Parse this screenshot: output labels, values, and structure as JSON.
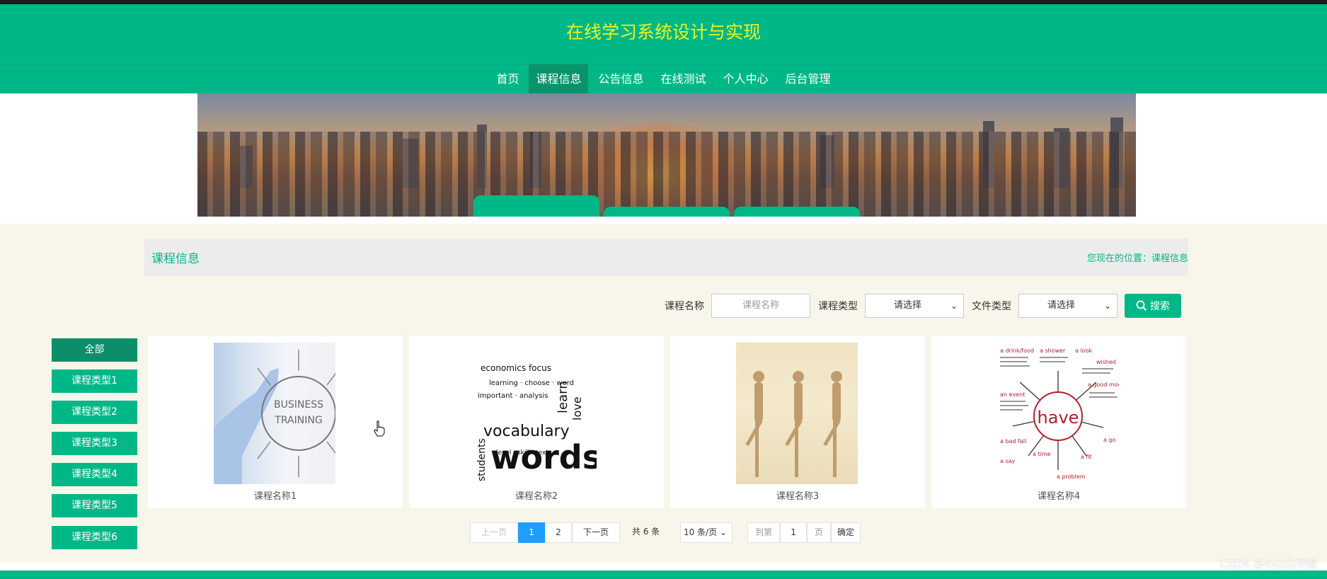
{
  "header": {
    "title": "在线学习系统设计与实现",
    "nav": [
      {
        "label": "首页",
        "active": false
      },
      {
        "label": "课程信息",
        "active": true
      },
      {
        "label": "公告信息",
        "active": false
      },
      {
        "label": "在线测试",
        "active": false
      },
      {
        "label": "个人中心",
        "active": false
      },
      {
        "label": "后台管理",
        "active": false
      }
    ]
  },
  "section": {
    "title": "课程信息",
    "breadcrumb": "您现在的位置：课程信息"
  },
  "search": {
    "course_name_label": "课程名称",
    "course_name_placeholder": "课程名称",
    "course_type_label": "课程类型",
    "course_type_value": "请选择",
    "file_type_label": "文件类型",
    "file_type_value": "请选择",
    "search_button": "搜索"
  },
  "sidebar": {
    "items": [
      {
        "label": "全部",
        "active": true
      },
      {
        "label": "课程类型1",
        "active": false
      },
      {
        "label": "课程类型2",
        "active": false
      },
      {
        "label": "课程类型3",
        "active": false
      },
      {
        "label": "课程类型4",
        "active": false
      },
      {
        "label": "课程类型5",
        "active": false
      },
      {
        "label": "课程类型6",
        "active": false
      }
    ]
  },
  "courses": [
    {
      "name": "课程名称1",
      "image_text": "BUSINESS TRAINING"
    },
    {
      "name": "课程名称2",
      "image_text": "vocabulary words"
    },
    {
      "name": "课程名称3",
      "image_text": ""
    },
    {
      "name": "课程名称4",
      "image_text": "have"
    }
  ],
  "pagination": {
    "prev": "上一页",
    "pages": [
      "1",
      "2"
    ],
    "current": "1",
    "next": "下一页",
    "total": "共 6 条",
    "page_size": "10 条/页",
    "goto_label": "到第",
    "goto_value": "1",
    "page_unit": "页",
    "confirm": "确定"
  },
  "watermark": "CSDN @小山山学姐",
  "colors": {
    "brand": "#00b887",
    "title_yellow": "#f4f11b",
    "nav_active": "#09936b",
    "pager_active": "#1e9fff"
  }
}
